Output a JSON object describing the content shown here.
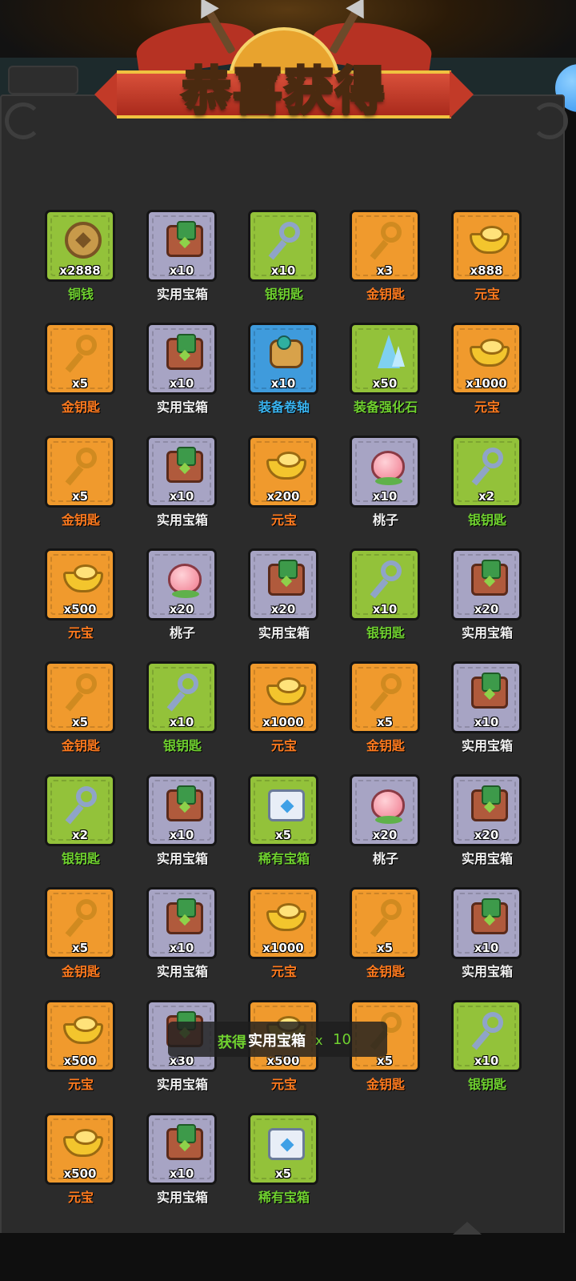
{
  "title": "恭喜获得",
  "toast": {
    "obtain": "获得",
    "item": "实用宝箱",
    "x": "x",
    "qty": "10"
  },
  "colors": {
    "green_quality": "#93c23a",
    "gray_quality": "#a7a4c4",
    "orange_quality": "#f09a2d",
    "blue_quality": "#3f9bdc",
    "name_green": "#6fd12f",
    "name_orange": "#ff7a1e",
    "name_blue": "#39b4f0",
    "title_gold": "#ffd43a"
  },
  "items": [
    {
      "name": "铜钱",
      "count": "x2888",
      "icon": "coin-icon",
      "quality": "green",
      "name_color": "green"
    },
    {
      "name": "实用宝箱",
      "count": "x10",
      "icon": "chest-icon",
      "quality": "gray",
      "name_color": "white"
    },
    {
      "name": "银钥匙",
      "count": "x10",
      "icon": "silver-key-icon",
      "quality": "green",
      "name_color": "green"
    },
    {
      "name": "金钥匙",
      "count": "x3",
      "icon": "gold-key-icon",
      "quality": "orange",
      "name_color": "orange"
    },
    {
      "name": "元宝",
      "count": "x888",
      "icon": "ingot-icon",
      "quality": "orange",
      "name_color": "orange"
    },
    {
      "name": "金钥匙",
      "count": "x5",
      "icon": "gold-key-icon",
      "quality": "orange",
      "name_color": "orange"
    },
    {
      "name": "实用宝箱",
      "count": "x10",
      "icon": "chest-icon",
      "quality": "gray",
      "name_color": "white"
    },
    {
      "name": "装备卷轴",
      "count": "x10",
      "icon": "scroll-icon",
      "quality": "blue",
      "name_color": "blue"
    },
    {
      "name": "装备强化石",
      "count": "x50",
      "icon": "crystal-icon",
      "quality": "green",
      "name_color": "green"
    },
    {
      "name": "元宝",
      "count": "x1000",
      "icon": "ingot-icon",
      "quality": "orange",
      "name_color": "orange"
    },
    {
      "name": "金钥匙",
      "count": "x5",
      "icon": "gold-key-icon",
      "quality": "orange",
      "name_color": "orange"
    },
    {
      "name": "实用宝箱",
      "count": "x10",
      "icon": "chest-icon",
      "quality": "gray",
      "name_color": "white"
    },
    {
      "name": "元宝",
      "count": "x200",
      "icon": "ingot-icon",
      "quality": "orange",
      "name_color": "orange"
    },
    {
      "name": "桃子",
      "count": "x10",
      "icon": "peach-icon",
      "quality": "gray",
      "name_color": "white"
    },
    {
      "name": "银钥匙",
      "count": "x2",
      "icon": "silver-key-icon",
      "quality": "green",
      "name_color": "green"
    },
    {
      "name": "元宝",
      "count": "x500",
      "icon": "ingot-icon",
      "quality": "orange",
      "name_color": "orange"
    },
    {
      "name": "桃子",
      "count": "x20",
      "icon": "peach-icon",
      "quality": "gray",
      "name_color": "white"
    },
    {
      "name": "实用宝箱",
      "count": "x20",
      "icon": "chest-icon",
      "quality": "gray",
      "name_color": "white"
    },
    {
      "name": "银钥匙",
      "count": "x10",
      "icon": "silver-key-icon",
      "quality": "green",
      "name_color": "green"
    },
    {
      "name": "实用宝箱",
      "count": "x20",
      "icon": "chest-icon",
      "quality": "gray",
      "name_color": "white"
    },
    {
      "name": "金钥匙",
      "count": "x5",
      "icon": "gold-key-icon",
      "quality": "orange",
      "name_color": "orange"
    },
    {
      "name": "银钥匙",
      "count": "x10",
      "icon": "silver-key-icon",
      "quality": "green",
      "name_color": "green"
    },
    {
      "name": "元宝",
      "count": "x1000",
      "icon": "ingot-icon",
      "quality": "orange",
      "name_color": "orange"
    },
    {
      "name": "金钥匙",
      "count": "x5",
      "icon": "gold-key-icon",
      "quality": "orange",
      "name_color": "orange"
    },
    {
      "name": "实用宝箱",
      "count": "x10",
      "icon": "chest-icon",
      "quality": "gray",
      "name_color": "white"
    },
    {
      "name": "银钥匙",
      "count": "x2",
      "icon": "silver-key-icon",
      "quality": "green",
      "name_color": "green"
    },
    {
      "name": "实用宝箱",
      "count": "x10",
      "icon": "chest-icon",
      "quality": "gray",
      "name_color": "white"
    },
    {
      "name": "稀有宝箱",
      "count": "x5",
      "icon": "rare-chest-icon",
      "quality": "green",
      "name_color": "green"
    },
    {
      "name": "桃子",
      "count": "x20",
      "icon": "peach-icon",
      "quality": "gray",
      "name_color": "white"
    },
    {
      "name": "实用宝箱",
      "count": "x20",
      "icon": "chest-icon",
      "quality": "gray",
      "name_color": "white"
    },
    {
      "name": "金钥匙",
      "count": "x5",
      "icon": "gold-key-icon",
      "quality": "orange",
      "name_color": "orange"
    },
    {
      "name": "实用宝箱",
      "count": "x10",
      "icon": "chest-icon",
      "quality": "gray",
      "name_color": "white"
    },
    {
      "name": "元宝",
      "count": "x1000",
      "icon": "ingot-icon",
      "quality": "orange",
      "name_color": "orange"
    },
    {
      "name": "金钥匙",
      "count": "x5",
      "icon": "gold-key-icon",
      "quality": "orange",
      "name_color": "orange"
    },
    {
      "name": "实用宝箱",
      "count": "x10",
      "icon": "chest-icon",
      "quality": "gray",
      "name_color": "white"
    },
    {
      "name": "元宝",
      "count": "x500",
      "icon": "ingot-icon",
      "quality": "orange",
      "name_color": "orange"
    },
    {
      "name": "实用宝箱",
      "count": "x30",
      "icon": "chest-icon",
      "quality": "gray",
      "name_color": "white"
    },
    {
      "name": "元宝",
      "count": "x500",
      "icon": "ingot-icon",
      "quality": "orange",
      "name_color": "orange"
    },
    {
      "name": "金钥匙",
      "count": "x5",
      "icon": "gold-key-icon",
      "quality": "orange",
      "name_color": "orange"
    },
    {
      "name": "银钥匙",
      "count": "x10",
      "icon": "silver-key-icon",
      "quality": "green",
      "name_color": "green"
    },
    {
      "name": "元宝",
      "count": "x500",
      "icon": "ingot-icon",
      "quality": "orange",
      "name_color": "orange"
    },
    {
      "name": "实用宝箱",
      "count": "x10",
      "icon": "chest-icon",
      "quality": "gray",
      "name_color": "white"
    },
    {
      "name": "稀有宝箱",
      "count": "x5",
      "icon": "rare-chest-icon",
      "quality": "green",
      "name_color": "green"
    }
  ]
}
